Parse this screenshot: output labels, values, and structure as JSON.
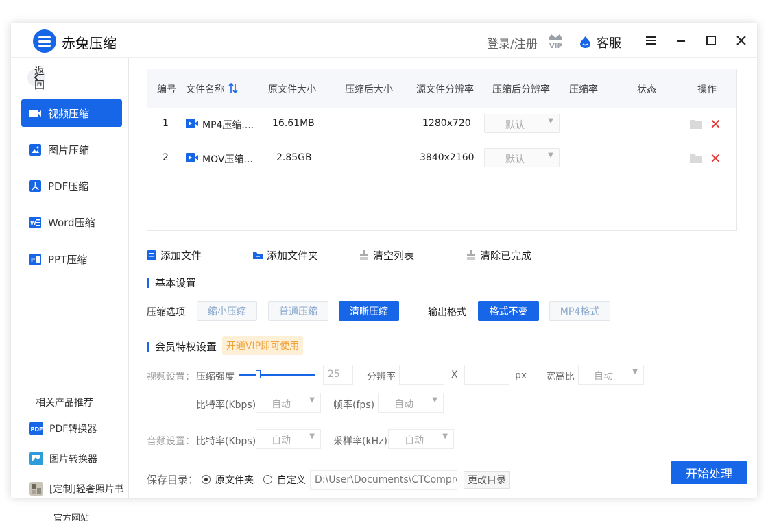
{
  "app": {
    "title": "赤兔压缩"
  },
  "header": {
    "login": "登录/注册",
    "service": "客服"
  },
  "sidebar": {
    "back": "返回",
    "items": [
      {
        "label": "视频压缩",
        "icon": "video-icon",
        "active": true
      },
      {
        "label": "图片压缩",
        "icon": "image-icon",
        "active": false
      },
      {
        "label": "PDF压缩",
        "icon": "pdf-icon",
        "active": false
      },
      {
        "label": "Word压缩",
        "icon": "word-icon",
        "active": false
      },
      {
        "label": "PPT压缩",
        "icon": "ppt-icon",
        "active": false
      }
    ],
    "related_title": "相关产品推荐",
    "related": [
      {
        "label": "PDF转换器",
        "icon": "pdf-converter-icon"
      },
      {
        "label": "图片转换器",
        "icon": "image-converter-icon"
      },
      {
        "label": "[定制]轻奢照片书",
        "icon": "photobook-icon"
      }
    ],
    "official": "官方网站"
  },
  "table": {
    "headers": [
      "编号",
      "文件名称",
      "原文件大小",
      "压缩后大小",
      "源文件分辨率",
      "压缩后分辨率",
      "压缩率",
      "状态",
      "操作"
    ],
    "rows": [
      {
        "num": "1",
        "name": "MP4压缩....",
        "size": "16.61MB",
        "compressed": "",
        "resolution": "1280x720",
        "target": "默认",
        "ratio": "",
        "status": ""
      },
      {
        "num": "2",
        "name": "MOV压缩...",
        "size": "2.85GB",
        "compressed": "",
        "resolution": "3840x2160",
        "target": "默认",
        "ratio": "",
        "status": ""
      }
    ]
  },
  "toolbar": {
    "add_file": "添加文件",
    "add_folder": "添加文件夹",
    "clear_list": "清空列表",
    "clear_done": "清除已完成"
  },
  "basic": {
    "title": "基本设置",
    "compress_label": "压缩选项",
    "options": [
      "缩小压缩",
      "普通压缩",
      "清晰压缩"
    ],
    "active_option": "清晰压缩",
    "format_label": "输出格式",
    "formats": [
      "格式不变",
      "MP4格式"
    ],
    "active_format": "格式不变"
  },
  "vip": {
    "title": "会员特权设置",
    "badge": "开通VIP即可使用",
    "video_label": "视频设置：",
    "strength_label": "压缩强度",
    "strength_value": "25",
    "strength_fraction": 0.22,
    "resolution_label": "分辨率",
    "x_label": "X",
    "px_label": "px",
    "aspect_label": "宽高比",
    "aspect_value": "自动",
    "bitrate_label": "比特率(Kbps)",
    "bitrate_value": "自动",
    "fps_label": "帧率(fps)",
    "fps_value": "自动",
    "audio_label": "音频设置：",
    "audio_bitrate_label": "比特率(Kbps)",
    "audio_bitrate_value": "自动",
    "sample_label": "采样率(kHz)",
    "sample_value": "自动"
  },
  "save": {
    "label": "保存目录：",
    "opt_original": "原文件夹",
    "opt_custom": "自定义",
    "path": "D:\\User\\Documents\\CTCompress",
    "change": "更改目录"
  },
  "start": "开始处理",
  "colors": {
    "accent": "#1766e8",
    "danger": "#e53935",
    "vip_bg": "#fdf0d6",
    "vip_text": "#f2a33a"
  }
}
